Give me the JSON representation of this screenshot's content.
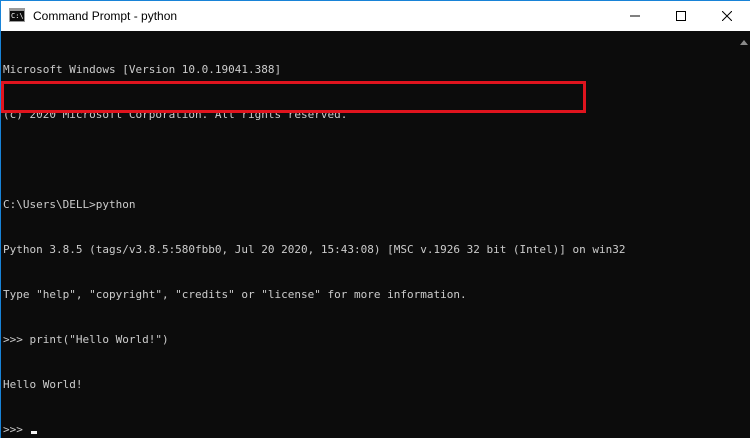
{
  "window": {
    "title": "Command Prompt - python"
  },
  "icons": {
    "app": "console-icon",
    "minimize": "minimize-icon",
    "maximize": "maximize-icon",
    "close": "close-icon",
    "scroll_up": "chevron-up-icon"
  },
  "app_icon_text": "C:\\",
  "console": {
    "lines": [
      "Microsoft Windows [Version 10.0.19041.388]",
      "(c) 2020 Microsoft Corporation. All rights reserved.",
      "",
      "C:\\Users\\DELL>python",
      "Python 3.8.5 (tags/v3.8.5:580fbb0, Jul 20 2020, 15:43:08) [MSC v.1926 32 bit (Intel)] on win32",
      "Type \"help\", \"copyright\", \"credits\" or \"license\" for more information.",
      ">>> print(\"Hello World!\")",
      "Hello World!",
      ">>> "
    ]
  },
  "colors": {
    "console_bg": "#0c0c0c",
    "console_text": "#cccccc",
    "highlight_border": "#e0141e",
    "window_border": "#1883d7"
  }
}
